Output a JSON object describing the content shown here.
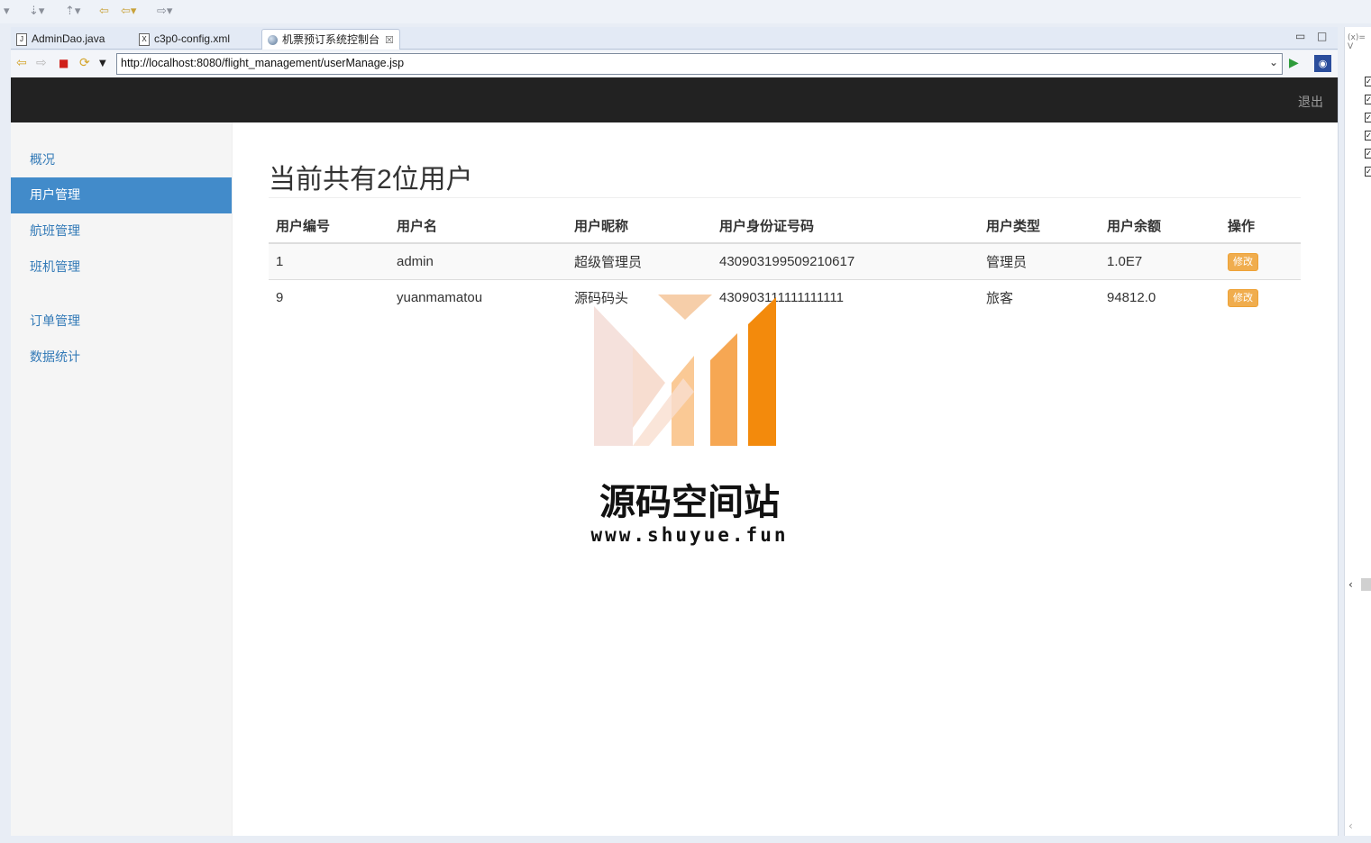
{
  "ide": {
    "tabs": [
      {
        "label": "AdminDao.java",
        "icon": "java-file-icon"
      },
      {
        "label": "c3p0-config.xml",
        "icon": "xml-file-icon"
      },
      {
        "label": "机票预订系统控制台",
        "icon": "globe-icon"
      }
    ],
    "right_panel_label": "(x)= V"
  },
  "browser": {
    "url": "http://localhost:8080/flight_management/userManage.jsp"
  },
  "navbar": {
    "logout_label": "退出"
  },
  "sidebar": {
    "items": [
      {
        "label": "概况"
      },
      {
        "label": "用户管理",
        "active": true
      },
      {
        "label": "航班管理"
      },
      {
        "label": "班机管理"
      },
      {
        "label": "订单管理"
      },
      {
        "label": "数据统计"
      }
    ]
  },
  "main": {
    "title": "当前共有2位用户",
    "columns": [
      "用户编号",
      "用户名",
      "用户昵称",
      "用户身份证号码",
      "用户类型",
      "用户余额",
      "操作"
    ],
    "rows": [
      {
        "id": "1",
        "username": "admin",
        "nickname": "超级管理员",
        "id_card": "430903199509210617",
        "type": "管理员",
        "balance": "1.0E7",
        "action": "修改"
      },
      {
        "id": "9",
        "username": "yuanmamatou",
        "nickname": "源码码头",
        "id_card": "430903111111111111",
        "type": "旅客",
        "balance": "94812.0",
        "action": "修改"
      }
    ]
  },
  "watermark": {
    "title": "源码空间站",
    "url": "www.shuyue.fun"
  },
  "colors": {
    "navbar_bg": "#222222",
    "active_nav": "#428bca",
    "link": "#337ab7",
    "edit_button": "#f0ad4e"
  }
}
